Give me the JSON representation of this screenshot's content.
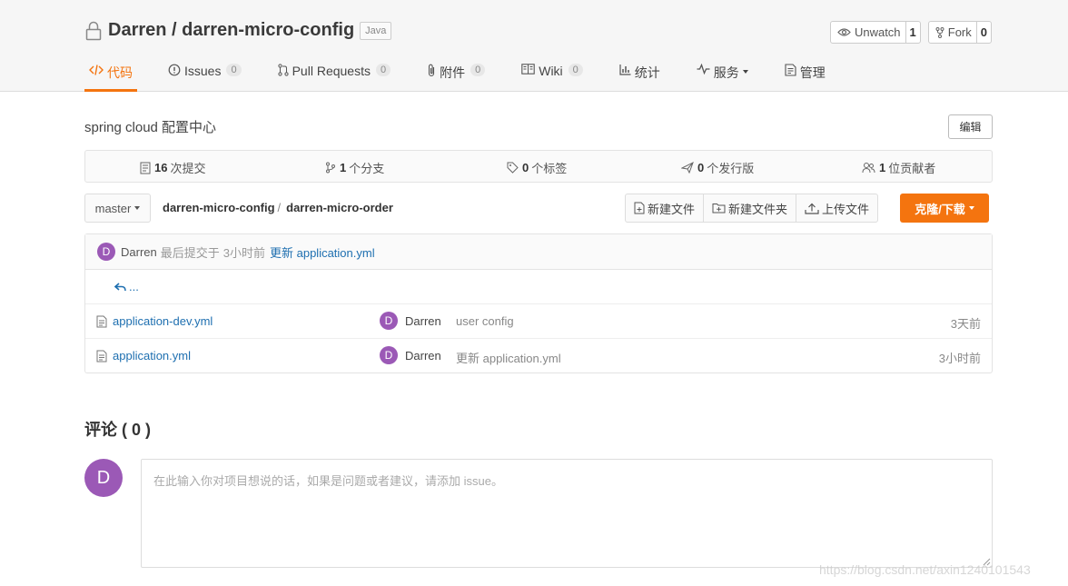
{
  "repo": {
    "title": "Darren / darren-micro-config",
    "language": "Java",
    "unwatch_label": "Unwatch",
    "unwatch_count": "1",
    "fork_label": "Fork",
    "fork_count": "0"
  },
  "tabs": [
    {
      "label": "代码",
      "count": null,
      "active": true,
      "icon": "code-icon"
    },
    {
      "label": "Issues",
      "count": "0",
      "icon": "issue-icon"
    },
    {
      "label": "Pull Requests",
      "count": "0",
      "icon": "pull-request-icon"
    },
    {
      "label": "附件",
      "count": "0",
      "icon": "attachment-icon"
    },
    {
      "label": "Wiki",
      "count": "0",
      "icon": "wiki-icon"
    },
    {
      "label": "统计",
      "count": null,
      "icon": "stats-icon"
    },
    {
      "label": "服务",
      "count": null,
      "icon": "service-icon"
    },
    {
      "label": "管理",
      "count": null,
      "icon": "admin-icon"
    }
  ],
  "description": "spring cloud 配置中心",
  "edit_label": "编辑",
  "stats": {
    "commits_num": "16",
    "commits_label": "次提交",
    "branches_num": "1",
    "branches_label": "个分支",
    "tags_num": "0",
    "tags_label": "个标签",
    "releases_num": "0",
    "releases_label": "个发行版",
    "contributors_num": "1",
    "contributors_label": "位贡献者"
  },
  "toolbar": {
    "branch": "master",
    "crumb_root": "darren-micro-config",
    "crumb_sep": "/",
    "crumb_current": "darren-micro-order",
    "new_file": "新建文件",
    "new_folder": "新建文件夹",
    "upload": "上传文件",
    "clone": "克隆/下载"
  },
  "last_commit": {
    "avatar": "D",
    "author": "Darren",
    "text": "最后提交于",
    "time": "3小时前",
    "message": "更新 application.yml"
  },
  "back_label": "...",
  "files": [
    {
      "name": "application-dev.yml",
      "avatar": "D",
      "author": "Darren",
      "message": "user config",
      "time": "3天前"
    },
    {
      "name": "application.yml",
      "avatar": "D",
      "author": "Darren",
      "message": "更新 application.yml",
      "time": "3小时前"
    }
  ],
  "comments": {
    "title": "评论 ( 0 )",
    "avatar": "D",
    "placeholder": "在此输入你对项目想说的话，如果是问题或者建议，请添加 issue。"
  },
  "watermark": "https://blog.csdn.net/axin1240101543",
  "colors": {
    "accent": "#f4740f",
    "link": "#1e6fb0",
    "avatar": "#9b59b6"
  }
}
